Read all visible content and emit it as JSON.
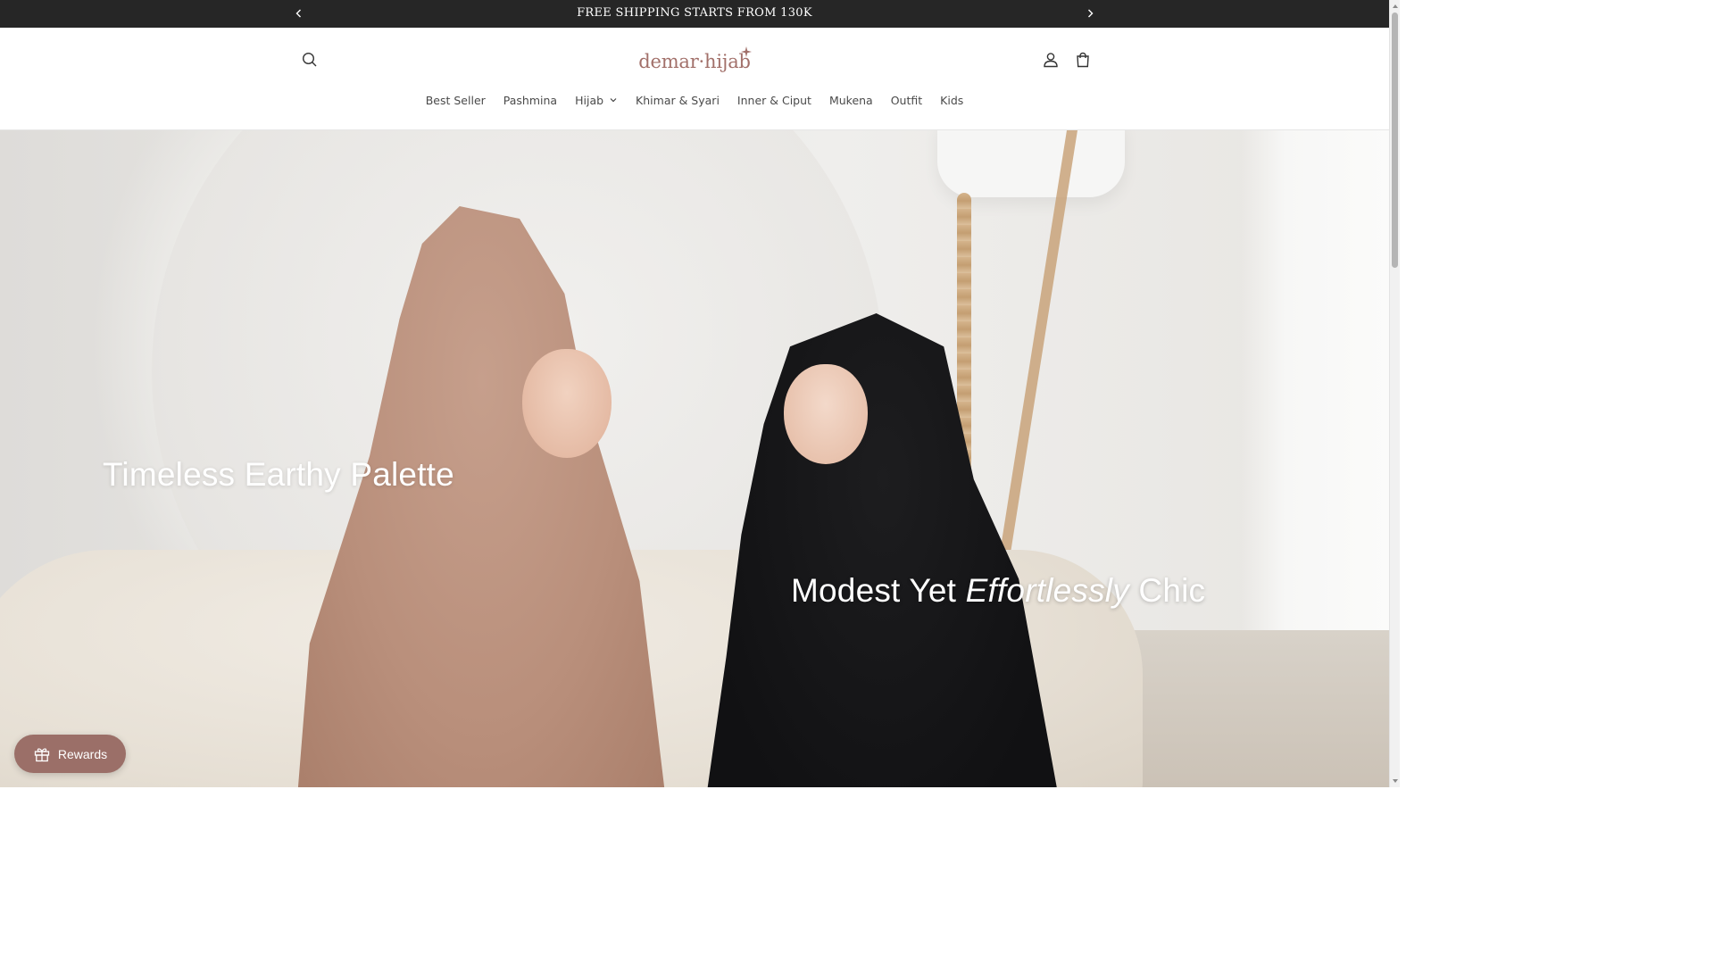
{
  "announcement": {
    "text": "FREE SHIPPING STARTS FROM 130K",
    "prev_icon": "chevron-left-icon",
    "next_icon": "chevron-right-icon"
  },
  "header": {
    "logo_text": "demar·hijab",
    "icons": {
      "search": "search-icon",
      "account": "user-icon",
      "cart": "bag-icon"
    }
  },
  "nav": {
    "items": [
      {
        "label": "Best Seller"
      },
      {
        "label": "Pashmina"
      },
      {
        "label": "Hijab",
        "has_dropdown": true
      },
      {
        "label": "Khimar & Syari"
      },
      {
        "label": "Inner & Ciput"
      },
      {
        "label": "Mukena"
      },
      {
        "label": "Outfit"
      },
      {
        "label": "Kids"
      }
    ]
  },
  "hero": {
    "headline_1": "Timeless Earthy Palette",
    "headline_2_pre": "Modest Yet ",
    "headline_2_em": "Effortlessly",
    "headline_2_post": " Chic"
  },
  "rewards": {
    "label": "Rewards",
    "icon": "gift-icon"
  },
  "colors": {
    "announcement_bg": "#262626",
    "brand": "#a2706a",
    "rewards_bg": "#9b6f68"
  }
}
